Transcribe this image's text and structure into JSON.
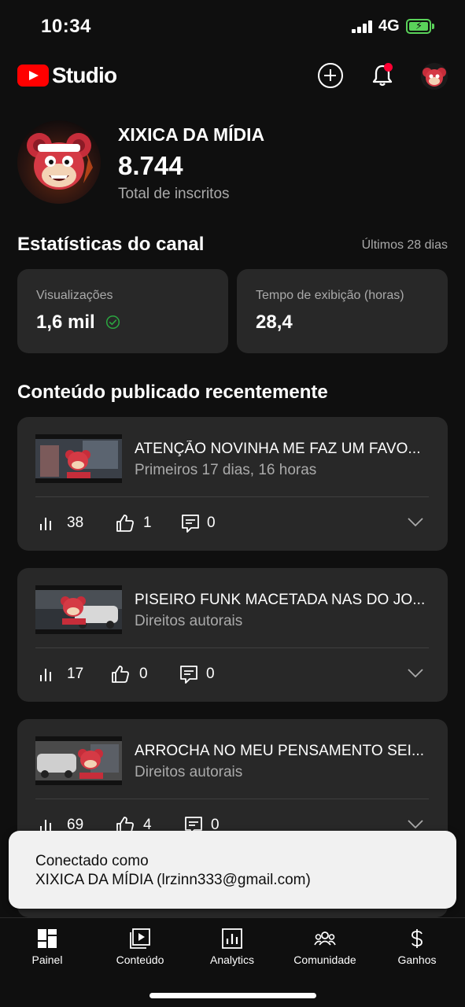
{
  "status_bar": {
    "time": "10:34",
    "network": "4G"
  },
  "header": {
    "studio_label": "Studio"
  },
  "channel": {
    "name": "XIXICA DA MÍDIA",
    "subscribers": "8.744",
    "subscribers_label": "Total de inscritos"
  },
  "stats": {
    "title": "Estatísticas do canal",
    "period": "Últimos 28 dias",
    "cards": [
      {
        "label": "Visualizações",
        "value": "1,6 mil"
      },
      {
        "label": "Tempo de exibição (horas)",
        "value": "28,4"
      }
    ]
  },
  "recent": {
    "title": "Conteúdo publicado recentemente",
    "videos": [
      {
        "title": "ATENÇÃO NOVINHA ME FAZ UM FAVO...",
        "status": "Primeiros 17 dias, 16 horas",
        "views": "38",
        "likes": "1",
        "comments": "0"
      },
      {
        "title": "PISEIRO FUNK MACETADA NAS DO JO...",
        "status": "Direitos autorais",
        "views": "17",
        "likes": "0",
        "comments": "0"
      },
      {
        "title": "ARROCHA NO MEU PENSAMENTO SEI...",
        "status": "Direitos autorais",
        "views": "69",
        "likes": "4",
        "comments": "0"
      }
    ]
  },
  "toast": {
    "line1": "Conectado como",
    "line2": "XIXICA DA MÍDIA (lrzinn333@gmail.com)"
  },
  "nav": {
    "items": [
      {
        "label": "Painel",
        "icon": "dashboard-icon"
      },
      {
        "label": "Conteúdo",
        "icon": "content-icon"
      },
      {
        "label": "Analytics",
        "icon": "analytics-icon"
      },
      {
        "label": "Comunidade",
        "icon": "community-icon"
      },
      {
        "label": "Ganhos",
        "icon": "earnings-icon"
      }
    ]
  },
  "colors": {
    "background": "#0f0f0f",
    "card": "#282828",
    "brand_red": "#ff0000",
    "secondary_text": "#aaaaaa",
    "success_green": "#2ba640"
  }
}
